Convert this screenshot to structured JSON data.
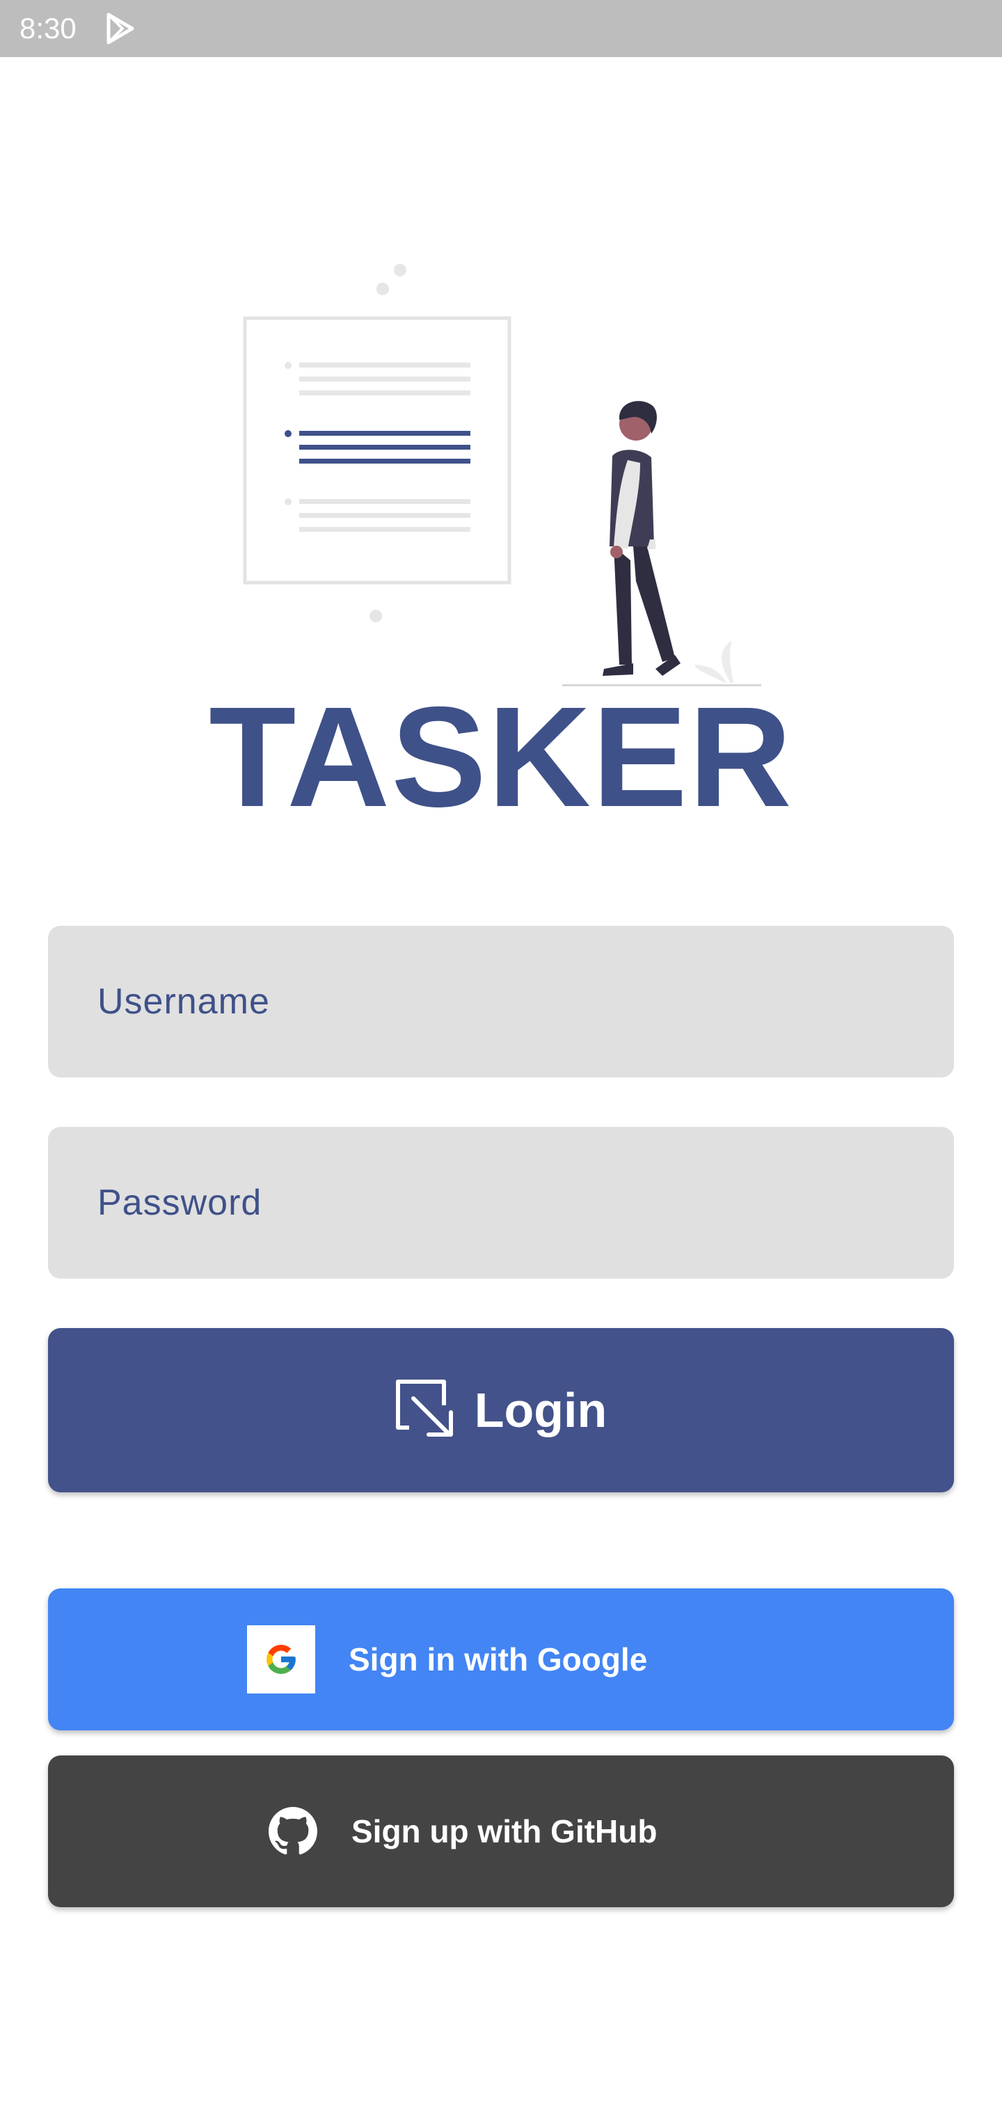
{
  "status_bar": {
    "time": "8:30",
    "icon": "play-store-icon"
  },
  "app": {
    "title": "TASKER",
    "illustration": "person-with-task-list-illustration"
  },
  "form": {
    "username_placeholder": "Username",
    "username_value": "",
    "password_placeholder": "Password",
    "password_value": ""
  },
  "login_button": {
    "label": "Login",
    "icon": "login-arrow-icon"
  },
  "google_button": {
    "label": "Sign in with Google",
    "icon": "google-logo-icon"
  },
  "github_button": {
    "label": "Sign up with GitHub",
    "icon": "github-logo-icon"
  },
  "colors": {
    "brand": "#3f5189",
    "login_bg": "#43528a",
    "google_bg": "#4385f4",
    "github_bg": "#444444",
    "field_bg": "#e0e0e0",
    "status_bar_bg": "#bdbdbd"
  }
}
